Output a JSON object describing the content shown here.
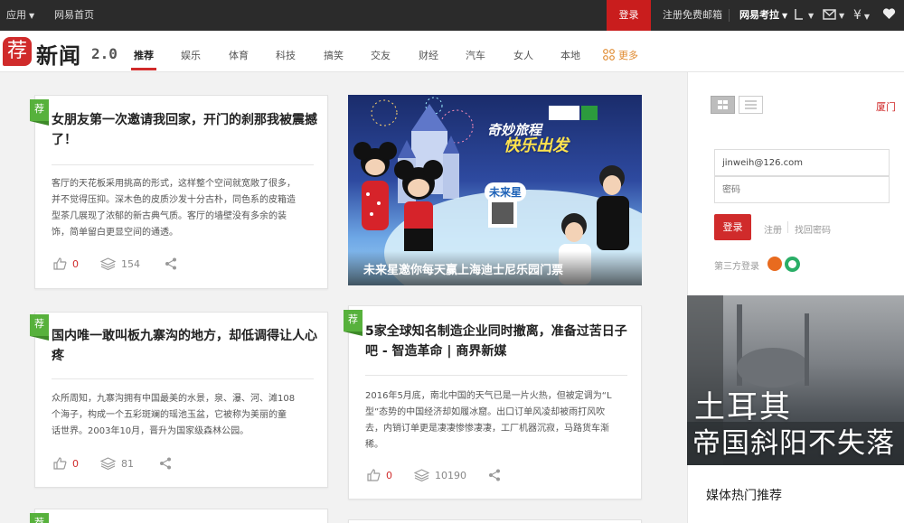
{
  "topbar": {
    "apps": "应用",
    "home": "网易首页",
    "login": "登录",
    "register_mail": "注册免费邮箱",
    "kaola": "网易考拉"
  },
  "header": {
    "logo_char": "荐",
    "logo_text": "新闻",
    "logo_version": "2.0",
    "nav": [
      "推荐",
      "娱乐",
      "体育",
      "科技",
      "搞笑",
      "交友",
      "财经",
      "汽车",
      "女人",
      "本地"
    ],
    "more": "更多"
  },
  "cards": [
    {
      "tag": "荐",
      "title_l1": "女朋友第一次邀请我回家，开门的刹那我被震撼",
      "title_l2": "了！",
      "desc": [
        "客厅的天花板采用挑高的形式，这样整个空间就宽敞了很多，",
        "并不觉得压抑。深木色的皮质沙发十分古朴，同色系的皮箱造",
        "型茶几展现了浓郁的新古典气质。客厅的墙壁没有多余的装",
        "饰，简单留白更显空间的通透。"
      ],
      "likes": "0",
      "views": "154"
    },
    {
      "tag": "荐",
      "title_l1": "国内唯一敢叫板九寨沟的地方，却低调得让人心",
      "title_l2": "疼",
      "desc": [
        "众所周知，九寨沟拥有中国最美的水景，泉、瀑、河、滩108",
        "个海子，构成一个五彩斑斓的瑶池玉盆，它被称为美丽的童",
        "话世界。2003年10月，晋升为国家级森林公园。"
      ],
      "likes": "0",
      "views": "81"
    },
    {
      "tag": "荐",
      "title_l1": "5家全球知名制造企业同时撤离，准备过苦日子",
      "title_l2": "吧 - 智造革命 | 商界新媒",
      "desc": [
        "2016年5月底，南北中国的天气已是一片火热，但被定调为“L",
        "型”态势的中国经济却如履冰窟。出口订单风凌却被雨打风吹",
        "去，内销订单更是凄凄惨惨凄凄，工厂机器沉寂，马路货车渐",
        "稀。"
      ],
      "likes": "0",
      "views": "10190"
    },
    {
      "tag": "荐"
    }
  ],
  "ad": {
    "caption": "未来星邀你每天赢上海迪士尼乐园门票",
    "slogan_l1": "奇妙旅程",
    "slogan_l2": "快乐出发",
    "brand": "未来星"
  },
  "sidebar": {
    "city": "厦门",
    "email_value": "jinweih@126.com",
    "password_placeholder": "密码",
    "login": "登录",
    "register": "注册",
    "forgot": "找回密码",
    "third_party": "第三方登录",
    "photo_line1": "土耳其",
    "photo_line2": "帝国斜阳不失落",
    "media_title": "媒体热门推荐"
  },
  "colors": {
    "accent_red": "#d02b2b",
    "tag_green": "#57b13c",
    "more_orange": "#e08a2f"
  }
}
